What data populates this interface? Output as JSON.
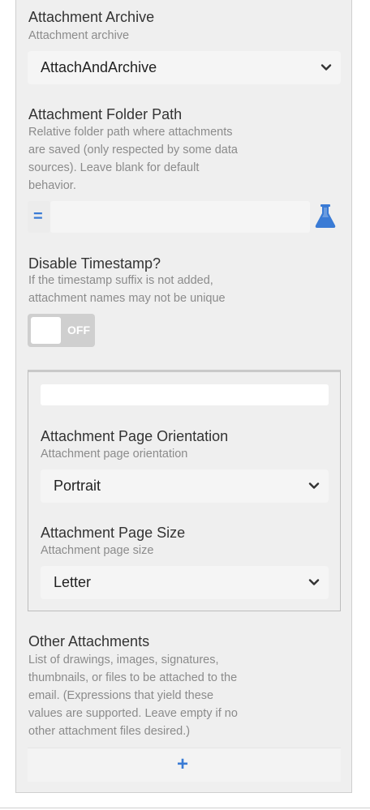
{
  "attachment_archive": {
    "title": "Attachment Archive",
    "description": "Attachment archive",
    "selected": "AttachAndArchive"
  },
  "attachment_folder_path": {
    "title": "Attachment Folder Path",
    "description_lines": [
      "Relative folder path where attachments",
      "are saved (only respected by some data",
      "sources). Leave blank for default",
      "behavior."
    ],
    "value": "",
    "expression_symbol": "="
  },
  "disable_timestamp": {
    "title": "Disable Timestamp?",
    "description_lines": [
      "If the timestamp suffix is not added,",
      "attachment names may not be unique"
    ],
    "toggle_label": "OFF",
    "toggle_state": false
  },
  "group": {
    "top_input_value": "",
    "page_orientation": {
      "title": "Attachment Page Orientation",
      "description": "Attachment page orientation",
      "selected": "Portrait"
    },
    "page_size": {
      "title": "Attachment Page Size",
      "description": "Attachment page size",
      "selected": "Letter"
    }
  },
  "other_attachments": {
    "title": "Other Attachments",
    "description_lines": [
      "List of drawings, images, signatures,",
      "thumbnails, or files to be attached to the",
      "email. (Expressions that yield these",
      "values are supported. Leave empty if no",
      "other attachment files desired.)"
    ],
    "add_symbol": "+"
  },
  "colors": {
    "accent": "#3a7bd5",
    "panel_bg": "#efefef",
    "field_bg": "#f5f5f5"
  },
  "icons": {
    "expression": "equals-icon",
    "test": "flask-icon",
    "dropdown": "chevron-down-icon",
    "add": "plus-icon"
  }
}
